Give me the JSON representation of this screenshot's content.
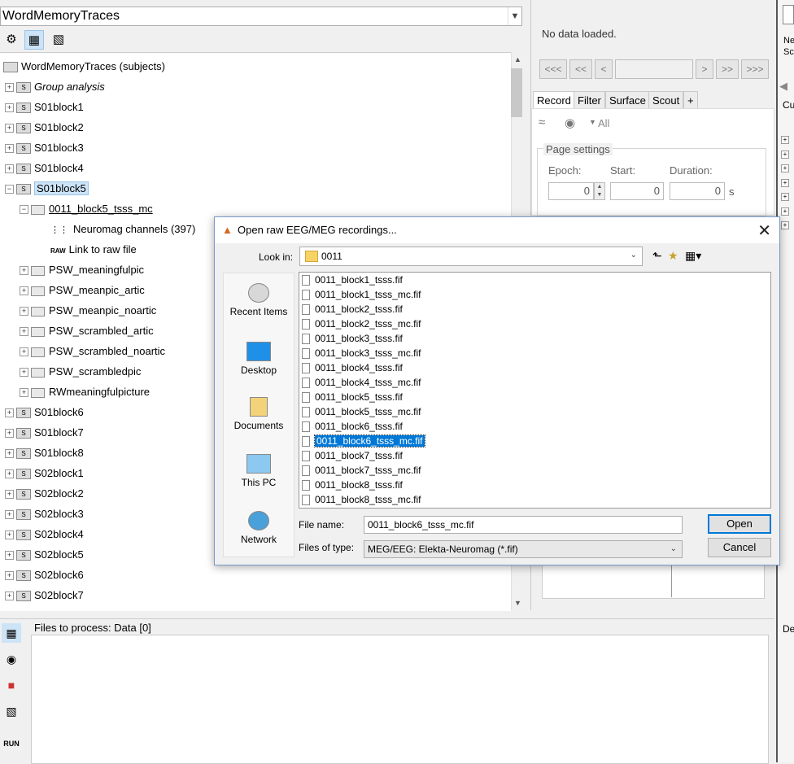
{
  "left": {
    "protocol": "WordMemoryTraces",
    "tree": {
      "root": "WordMemoryTraces (subjects)",
      "group": "Group analysis",
      "subjects_top": [
        "S01block1",
        "S01block2",
        "S01block3",
        "S01block4",
        "S01block5"
      ],
      "selected_subject": "S01block5",
      "raw_condition": "0011_block5_tsss_mc",
      "channels": "Neuromag channels (397)",
      "raw_link": "Link to raw file",
      "raw_label": "RAW",
      "conditions": [
        "PSW_meaningfulpic",
        "PSW_meanpic_artic",
        "PSW_meanpic_noartic",
        "PSW_scrambled_artic",
        "PSW_scrambled_noartic",
        "PSW_scrambledpic",
        "RWmeaningfulpicture"
      ],
      "subjects_bottom": [
        "S01block6",
        "S01block7",
        "S01block8",
        "S02block1",
        "S02block2",
        "S02block3",
        "S02block4",
        "S02block5",
        "S02block6",
        "S02block7"
      ]
    }
  },
  "right": {
    "status": "No data loaded.",
    "nav": [
      "<<<",
      "<<",
      "<",
      ">",
      ">>",
      ">>>"
    ],
    "tabs": [
      "Record",
      "Filter",
      "Surface",
      "Scout",
      "+"
    ],
    "filter_all": "All",
    "page_settings": "Page settings",
    "epoch_label": "Epoch:",
    "start_label": "Start:",
    "duration_label": "Duration:",
    "epoch_value": "0",
    "start_value": "0",
    "duration_value": "0",
    "unit": "s"
  },
  "far_right": {
    "top1": "Ne",
    "top2": "Sc",
    "cu": "Cu",
    "de": "De"
  },
  "bottom": {
    "title": "Files to process: Data [0]",
    "run": "RUN"
  },
  "dialog": {
    "title": "Open raw EEG/MEG recordings...",
    "look_in_label": "Look in:",
    "look_in_value": "0011",
    "places": [
      "Recent Items",
      "Desktop",
      "Documents",
      "This PC",
      "Network"
    ],
    "files": [
      "0011_block1_tsss.fif",
      "0011_block1_tsss_mc.fif",
      "0011_block2_tsss.fif",
      "0011_block2_tsss_mc.fif",
      "0011_block3_tsss.fif",
      "0011_block3_tsss_mc.fif",
      "0011_block4_tsss.fif",
      "0011_block4_tsss_mc.fif",
      "0011_block5_tsss.fif",
      "0011_block5_tsss_mc.fif",
      "0011_block6_tsss.fif",
      "0011_block6_tsss_mc.fif",
      "0011_block7_tsss.fif",
      "0011_block7_tsss_mc.fif",
      "0011_block8_tsss.fif",
      "0011_block8_tsss_mc.fif"
    ],
    "selected_file": "0011_block6_tsss_mc.fif",
    "file_name_label": "File name:",
    "file_name_value": "0011_block6_tsss_mc.fif",
    "file_type_label": "Files of type:",
    "file_type_value": "MEG/EEG: Elekta-Neuromag (*.fif)",
    "open": "Open",
    "cancel": "Cancel"
  }
}
